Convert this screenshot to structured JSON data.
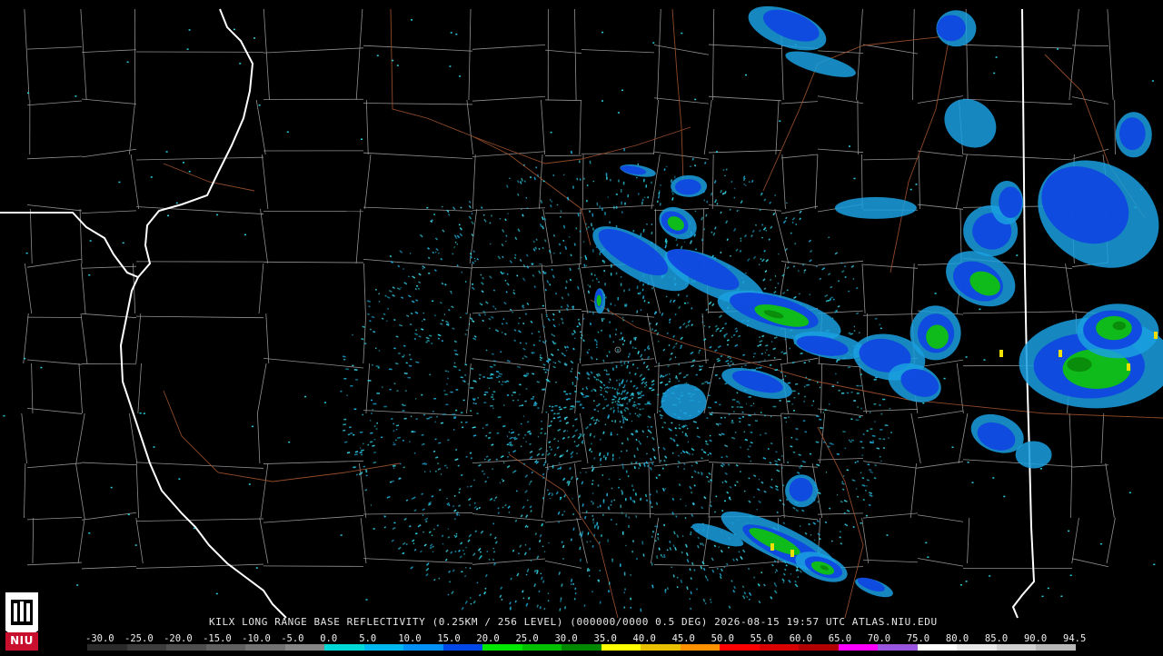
{
  "product": {
    "caption": "KILX LONG RANGE BASE REFLECTIVITY (0.25KM / 256 LEVEL) (000000/0000 0.5 DEG) 2026-08-15 19:57 UTC  ATLAS.NIU.EDU"
  },
  "logo": {
    "text": "NIU",
    "icon": "university-shield-icon"
  },
  "legend": {
    "labels": [
      "-30.0",
      "-25.0",
      "-20.0",
      "-15.0",
      "-10.0",
      "-5.0",
      "0.0",
      "5.0",
      "10.0",
      "15.0",
      "20.0",
      "25.0",
      "30.0",
      "35.0",
      "40.0",
      "45.0",
      "50.0",
      "55.0",
      "60.0",
      "65.0",
      "70.0",
      "75.0",
      "80.0",
      "85.0",
      "90.0",
      "94.5"
    ],
    "colors": [
      "#2a2a2a",
      "#3c3c3c",
      "#4e4e4e",
      "#606060",
      "#727272",
      "#868686",
      "#00d8d8",
      "#00b8f0",
      "#0090f8",
      "#0048e8",
      "#00e800",
      "#00c000",
      "#008800",
      "#ffff00",
      "#e8c000",
      "#ff9000",
      "#ff0000",
      "#d80000",
      "#b00000",
      "#ff00ff",
      "#9955dd",
      "#ffffff",
      "#e8e8e8",
      "#d0d0d0",
      "#b8b8b8"
    ]
  },
  "colors": {
    "background": "#000000",
    "county_line": "#b0b0b0",
    "state_line": "#ffffff",
    "highway": "#a0522d",
    "ground_clutter": "#2ad0e0"
  }
}
